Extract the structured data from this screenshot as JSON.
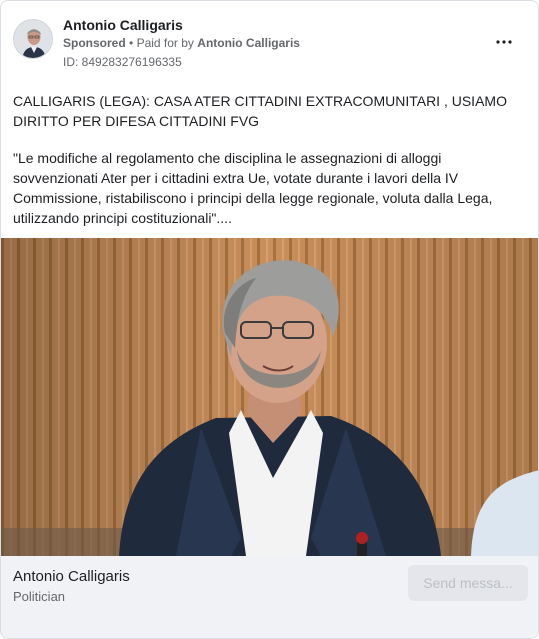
{
  "ad": {
    "page_name": "Antonio Calligaris",
    "sponsored_label": "Sponsored",
    "bullet": "•",
    "paid_prefix": "Paid for by",
    "paid_by": "Antonio Calligaris",
    "ad_id": "ID: 849283276196335",
    "more_icon": "ellipsis-horizontal-icon"
  },
  "post": {
    "headline": "CALLIGARIS (LEGA): CASA ATER CITTADINI EXTRACOMUNITARI , USIAMO DIRITTO PER DIFESA CITTADINI FVG",
    "body": "\"Le modifiche al regolamento che disciplina le assegnazioni di alloggi sovvenzionati Ater per i cittadini extra Ue, votate durante i lavori della IV Commissione, ristabiliscono i principi della legge regionale, voluta dalla Lega, utilizzando principi costituzionali\"...."
  },
  "footer": {
    "name": "Antonio Calligaris",
    "category": "Politician",
    "send_button": "Send messa..."
  },
  "colors": {
    "background": "#ffffff",
    "footer_bg": "#f0f2f5",
    "secondary_text": "#65676b",
    "button_bg": "#e4e6eb",
    "button_text": "#bcc0c4"
  }
}
